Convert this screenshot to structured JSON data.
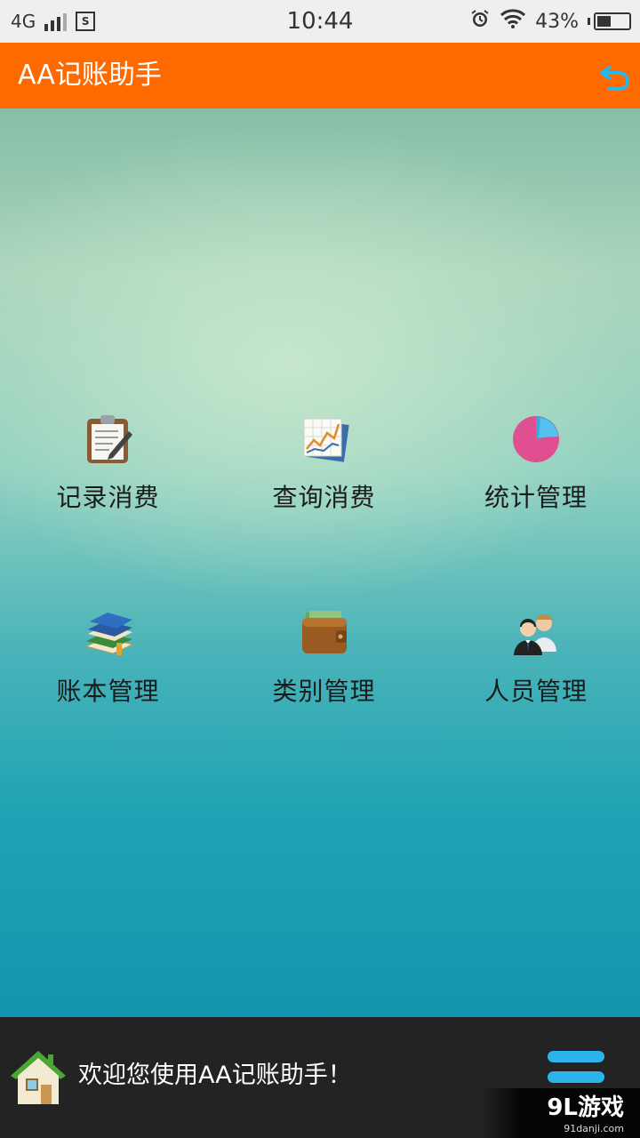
{
  "status_bar": {
    "network": "4G",
    "time": "10:44",
    "battery": "43%",
    "battery_level": 0.43
  },
  "app": {
    "title": "AA记账助手"
  },
  "menu": {
    "items": [
      {
        "label": "记录消费",
        "icon": "clipboard-icon"
      },
      {
        "label": "查询消费",
        "icon": "chart-icon"
      },
      {
        "label": "统计管理",
        "icon": "pie-chart-icon"
      },
      {
        "label": "账本管理",
        "icon": "books-icon"
      },
      {
        "label": "类别管理",
        "icon": "wallet-icon"
      },
      {
        "label": "人员管理",
        "icon": "people-icon"
      }
    ]
  },
  "footer": {
    "welcome": "欢迎您使用AA记账助手！",
    "watermark_logo": "9L游戏",
    "watermark_url": "91danji.com"
  },
  "colors": {
    "app_bar": "#ff6a00",
    "footer": "#232323",
    "accent": "#2ab4ea"
  }
}
